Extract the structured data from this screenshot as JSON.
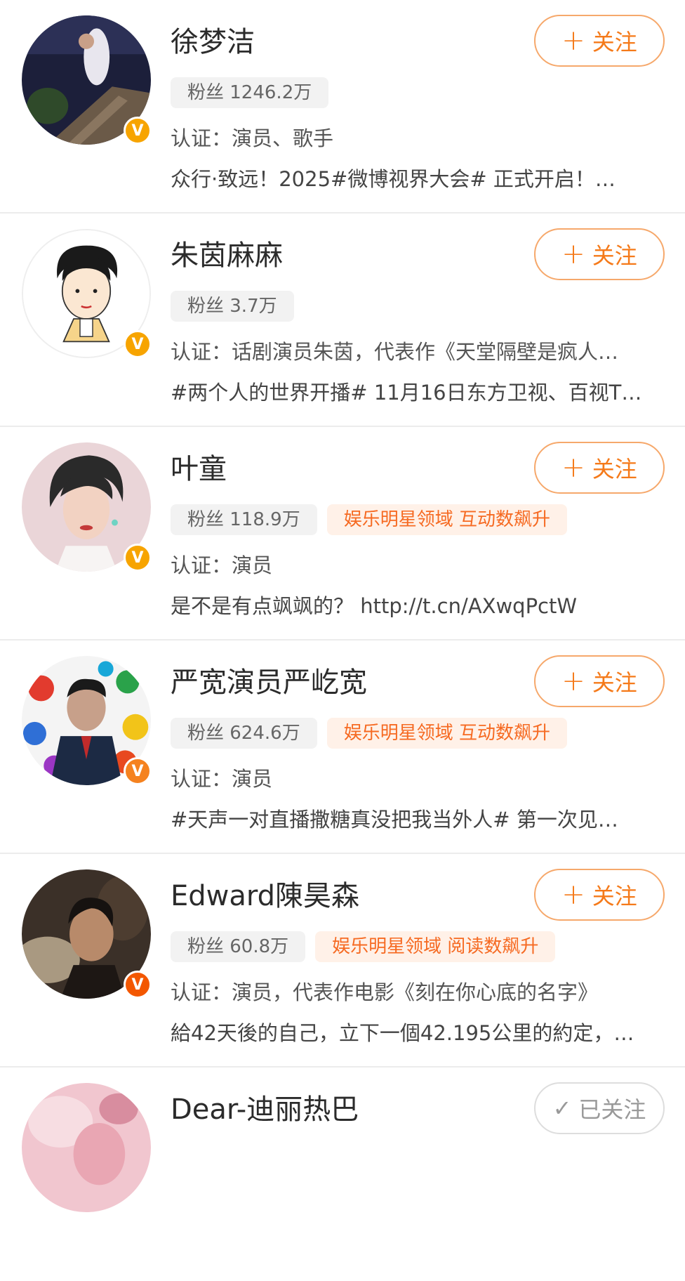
{
  "users": [
    {
      "name": "徐梦洁",
      "fans": "粉丝 1246.2万",
      "badge": "",
      "verify": "认证：演员、歌手",
      "post": "众行·致远！2025#微博视界大会# 正式开启！…",
      "follow_label": "关注",
      "follow_icon": "+",
      "vbadge": "V"
    },
    {
      "name": "朱茵麻麻",
      "fans": "粉丝 3.7万",
      "badge": "",
      "verify": "认证：话剧演员朱茵，代表作《天堂隔壁是疯人…",
      "post": "#两个人的世界开播# 11月16日东方卫视、百视T…",
      "follow_label": "关注",
      "follow_icon": "+",
      "vbadge": "V"
    },
    {
      "name": "叶童",
      "fans": "粉丝 118.9万",
      "badge": "娱乐明星领域 互动数飙升",
      "verify": "认证：演员",
      "post": "是不是有点飒飒的？ http://t.cn/AXwqPctW",
      "follow_label": "关注",
      "follow_icon": "+",
      "vbadge": "V"
    },
    {
      "name": "严宽演员严屹宽",
      "fans": "粉丝 624.6万",
      "badge": "娱乐明星领域 互动数飙升",
      "verify": "认证：演员",
      "post": "#天声一对直播撒糖真没把我当外人# 第一次见…",
      "follow_label": "关注",
      "follow_icon": "+",
      "vbadge": "V"
    },
    {
      "name": "Edward陳昊森",
      "fans": "粉丝 60.8万",
      "badge": "娱乐明星领域 阅读数飙升",
      "verify": "认证：演员，代表作电影《刻在你心底的名字》",
      "post": "給42天後的自己，立下一個42.195公里的約定，…",
      "follow_label": "关注",
      "follow_icon": "+",
      "vbadge": "V"
    },
    {
      "name": "Dear-迪丽热巴",
      "follow_label": "已关注",
      "follow_icon": "✓"
    }
  ]
}
